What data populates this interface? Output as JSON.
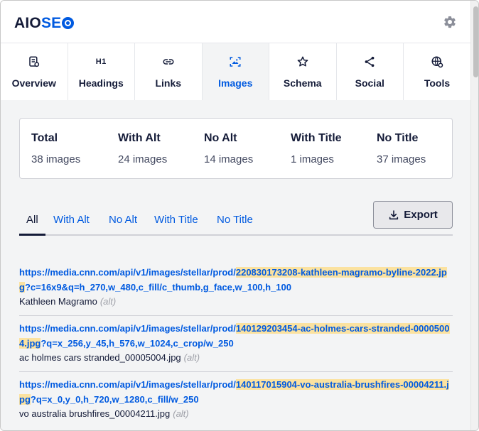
{
  "header": {
    "logo_aio": "AIO",
    "logo_se": "SE"
  },
  "tabs": [
    {
      "label": "Overview",
      "icon": "overview-icon",
      "active": false
    },
    {
      "label": "Headings",
      "icon": "h1-icon",
      "glyph": "H1",
      "active": false
    },
    {
      "label": "Links",
      "icon": "link-icon",
      "active": false
    },
    {
      "label": "Images",
      "icon": "image-icon",
      "active": true
    },
    {
      "label": "Schema",
      "icon": "star-icon",
      "active": false
    },
    {
      "label": "Social",
      "icon": "share-icon",
      "active": false
    },
    {
      "label": "Tools",
      "icon": "globe-tools-icon",
      "active": false
    }
  ],
  "stats": [
    {
      "title": "Total",
      "value": "38 images"
    },
    {
      "title": "With Alt",
      "value": "24 images"
    },
    {
      "title": "No Alt",
      "value": "14 images"
    },
    {
      "title": "With Title",
      "value": "1 images"
    },
    {
      "title": "No Title",
      "value": "37 images"
    }
  ],
  "filters": [
    "All",
    "With Alt",
    "No Alt",
    "With Title",
    "No Title"
  ],
  "export_label": "Export",
  "images": [
    {
      "url_prefix": "https://media.cnn.com/api/v1/images/stellar/prod/",
      "url_file": "220830173208-kathleen-magramo-byline-2022.jpg",
      "url_query": "?c=16x9&q=h_270,w_480,c_fill/c_thumb,g_face,w_100,h_100",
      "alt": "Kathleen Magramo",
      "tag": "(alt)"
    },
    {
      "url_prefix": "https://media.cnn.com/api/v1/images/stellar/prod/",
      "url_file": "140129203454-ac-holmes-cars-stranded-00005004.jpg",
      "url_query": "?q=x_256,y_45,h_576,w_1024,c_crop/w_250",
      "alt": "ac holmes cars stranded_00005004.jpg",
      "tag": "(alt)"
    },
    {
      "url_prefix": "https://media.cnn.com/api/v1/images/stellar/prod/",
      "url_file": "140117015904-vo-australia-brushfires-00004211.jpg",
      "url_query": "?q=x_0,y_0,h_720,w_1280,c_fill/w_250",
      "alt": "vo australia brushfires_00004211.jpg",
      "tag": "(alt)"
    }
  ],
  "colors": {
    "brand_blue": "#005ae0",
    "text_dark": "#141b38",
    "highlight": "#fbe2a0",
    "panel_bg": "#f3f4f5"
  }
}
